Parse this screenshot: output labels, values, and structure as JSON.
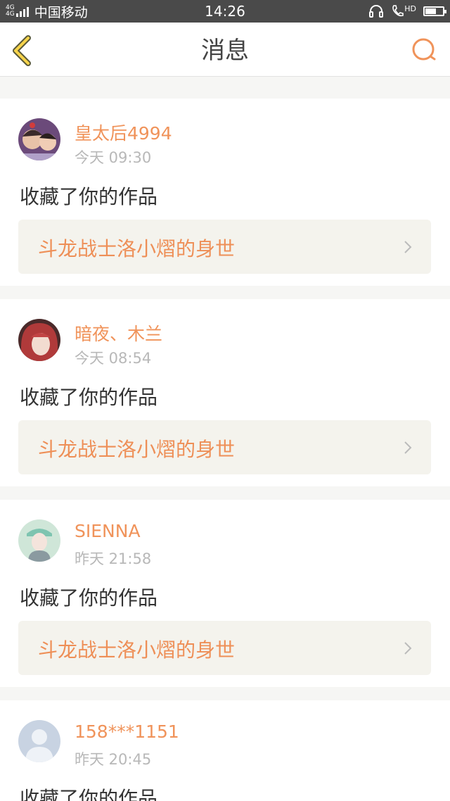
{
  "status_bar": {
    "network_top": "4G",
    "network_bottom": "4G",
    "carrier": "中国移动",
    "time": "14:26",
    "hd_label": "HD",
    "battery_level": 0.65
  },
  "header": {
    "title": "消息"
  },
  "messages": [
    {
      "username": "皇太后4994",
      "time": "今天 09:30",
      "action": "收藏了你的作品",
      "work_title": "斗龙战士洛小熠的身世"
    },
    {
      "username": "暗夜、木兰",
      "time": "今天 08:54",
      "action": "收藏了你的作品",
      "work_title": "斗龙战士洛小熠的身世"
    },
    {
      "username": "SIENNA",
      "time": "昨天 21:58",
      "action": "收藏了你的作品",
      "work_title": "斗龙战士洛小熠的身世"
    },
    {
      "username": "158***1151",
      "time": "昨天 20:45",
      "action": "收藏了你的作品"
    }
  ],
  "colors": {
    "accent": "#f0935a",
    "status_bar": "#4a4a4a",
    "page_bg": "#f6f6f4",
    "link_bg": "#f4f3ed"
  },
  "icons": {
    "back": "chevron-left-icon",
    "search": "search-icon",
    "chevron": "chevron-right-icon",
    "headset": "headset-icon",
    "call": "call-icon",
    "battery": "battery-icon"
  }
}
